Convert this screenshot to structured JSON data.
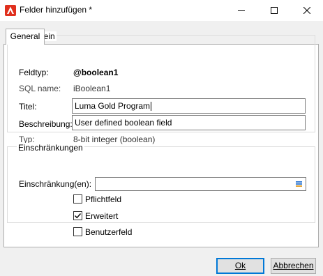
{
  "window": {
    "title": "Felder hinzufügen *",
    "icon": "adobe-icon",
    "controls": [
      "minimize-icon",
      "maximize-icon",
      "close-icon"
    ]
  },
  "tabs": [
    {
      "label": "General",
      "active": true
    }
  ],
  "general_group": {
    "legend": "Allgemein",
    "fields": [
      {
        "label": "Feldtyp:",
        "value": "@boolean1"
      },
      {
        "label": "SQL name:",
        "value": "iBoolean1"
      },
      {
        "label": "Titel:",
        "value": "Luma Gold Program"
      },
      {
        "label": "Beschreibung:",
        "value": "User defined boolean field"
      },
      {
        "label": "Typ:",
        "value": "8-bit integer (boolean)"
      }
    ]
  },
  "constraints_group": {
    "legend": "Einschränkungen",
    "constraint_label": "Einschränkung(en):",
    "constraint_value": "",
    "checkboxes": [
      {
        "label": "Pflichtfeld",
        "checked": false
      },
      {
        "label": "Erweitert",
        "checked": true
      },
      {
        "label": "Benutzerfeld",
        "checked": false
      }
    ]
  },
  "buttons": {
    "ok": "Ok",
    "cancel": "Abbrechen"
  },
  "colors": {
    "accent": "#0078d7",
    "brand_red": "#e0301e"
  }
}
